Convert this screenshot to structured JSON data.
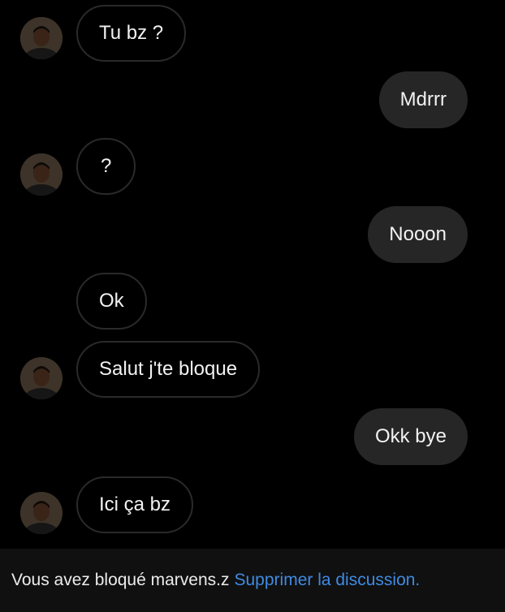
{
  "conversation": {
    "contact_username": "marvens.z",
    "messages": [
      {
        "sender": "contact",
        "text": "Tu bz ?",
        "has_avatar": true
      },
      {
        "sender": "me",
        "text": "Mdrrr"
      },
      {
        "sender": "contact",
        "text": "?",
        "has_avatar": true
      },
      {
        "sender": "me",
        "text": "Nooon"
      },
      {
        "sender": "contact",
        "text": "Ok",
        "has_avatar": false
      },
      {
        "sender": "contact",
        "text": "Salut j'te bloque",
        "has_avatar": true
      },
      {
        "sender": "me",
        "text": "Okk bye"
      },
      {
        "sender": "contact",
        "text": "Ici ça bz",
        "has_avatar": true
      }
    ]
  },
  "footer": {
    "blocked_notice": "Vous avez bloqué marvens.z",
    "delete_link": "Supprimer la discussion."
  },
  "colors": {
    "background": "#000000",
    "incoming_border": "#2a2a2a",
    "outgoing_bubble": "#262626",
    "footer_background": "#101010",
    "link": "#3f8be3"
  },
  "icons": {
    "avatar": "contact-avatar-photo"
  }
}
